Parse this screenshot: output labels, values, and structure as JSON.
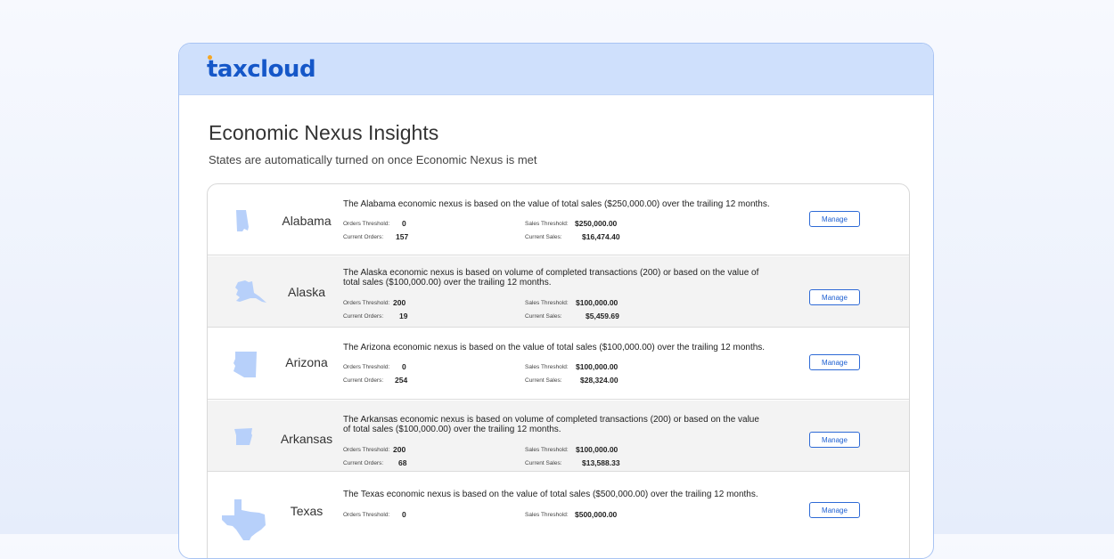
{
  "brand": {
    "logo_text": "taxcloud",
    "logo_color": "#1557c8",
    "dot_color": "#f5a623"
  },
  "page": {
    "title": "Economic Nexus Insights",
    "subtitle": "States are automatically turned on once Economic Nexus is met"
  },
  "labels": {
    "orders_threshold": "Orders Threshold:",
    "current_orders": "Current Orders:",
    "sales_threshold": "Sales Threshold:",
    "current_sales": "Current Sales:",
    "manage": "Manage"
  },
  "states": [
    {
      "name": "Alabama",
      "desc1": "The Alabama economic nexus is based on the value of total sales ($250,000.00) over the trailing 12 months.",
      "desc2": "",
      "orders_threshold": "0",
      "current_orders": "157",
      "sales_threshold": "$250,000.00",
      "current_sales": "$16,474.40"
    },
    {
      "name": "Alaska",
      "desc1": "The Alaska economic nexus is based on volume of completed transactions (200) or based on the value of",
      "desc2": "total sales ($100,000.00) over the trailing 12 months.",
      "orders_threshold": "200",
      "current_orders": "19",
      "sales_threshold": "$100,000.00",
      "current_sales": "$5,459.69"
    },
    {
      "name": "Arizona",
      "desc1": "The Arizona economic nexus is based on the value of total sales ($100,000.00) over the trailing 12 months.",
      "desc2": "",
      "orders_threshold": "0",
      "current_orders": "254",
      "sales_threshold": "$100,000.00",
      "current_sales": "$28,324.00"
    },
    {
      "name": "Arkansas",
      "desc1": "The Arkansas economic nexus is based on volume of completed transactions (200) or based on the value",
      "desc2": "of total sales ($100,000.00) over the trailing 12 months.",
      "orders_threshold": "200",
      "current_orders": "68",
      "sales_threshold": "$100,000.00",
      "current_sales": "$13,588.33"
    },
    {
      "name": "Texas",
      "desc1": "The Texas economic nexus is based on the value of total sales ($500,000.00) over the trailing 12 months.",
      "desc2": "",
      "orders_threshold": "0",
      "current_orders": "",
      "sales_threshold": "$500,000.00",
      "current_sales": ""
    }
  ],
  "colors": {
    "map_fill": "#b7d0fa",
    "accent": "#2e6ad6"
  }
}
